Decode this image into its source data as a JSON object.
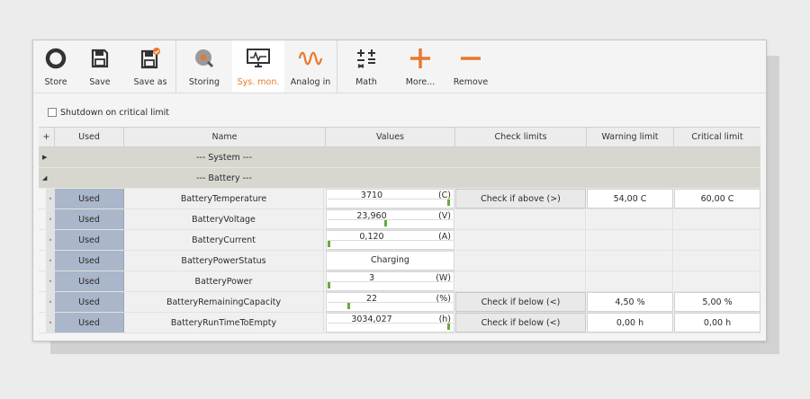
{
  "toolbar": {
    "groups": [
      [
        {
          "id": "store",
          "label": "Store",
          "icon": "circle-record-icon"
        },
        {
          "id": "save",
          "label": "Save",
          "icon": "floppy-disk-icon"
        },
        {
          "id": "saveas",
          "label": "Save as",
          "icon": "floppy-disk-edit-icon"
        }
      ],
      [
        {
          "id": "storing",
          "label": "Storing",
          "icon": "storing-disc-icon"
        },
        {
          "id": "sysmon",
          "label": "Sys. mon.",
          "icon": "monitor-waveform-icon",
          "active": true
        },
        {
          "id": "analogin",
          "label": "Analog in",
          "icon": "sine-wave-icon"
        }
      ],
      [
        {
          "id": "math",
          "label": "Math",
          "icon": "math-operators-icon"
        },
        {
          "id": "more",
          "label": "More...",
          "icon": "plus-icon"
        },
        {
          "id": "remove",
          "label": "Remove",
          "icon": "minus-icon"
        }
      ]
    ]
  },
  "shutdown_checkbox": {
    "label": "Shutdown on critical limit",
    "checked": false
  },
  "table": {
    "headers": {
      "expand": "+",
      "used": "Used",
      "name": "Name",
      "values": "Values",
      "check": "Check limits",
      "warning": "Warning limit",
      "critical": "Critical limit"
    },
    "groups": [
      {
        "label": "--- System ---",
        "expanded": false
      },
      {
        "label": "--- Battery ---",
        "expanded": true
      }
    ],
    "rows": [
      {
        "used": "Used",
        "name": "BatteryTemperature",
        "value": "3710",
        "unit": "(C)",
        "level": 0.98,
        "check": "Check if above (>)",
        "warning": "54,00 C",
        "critical": "60,00 C"
      },
      {
        "used": "Used",
        "name": "BatteryVoltage",
        "value": "23,960",
        "unit": "(V)",
        "level": 0.45,
        "check": "",
        "warning": "",
        "critical": ""
      },
      {
        "used": "Used",
        "name": "BatteryCurrent",
        "value": "0,120",
        "unit": "(A)",
        "level": 0.0,
        "check": "",
        "warning": "",
        "critical": ""
      },
      {
        "used": "Used",
        "name": "BatteryPowerStatus",
        "value": "",
        "text": "Charging",
        "unit": "",
        "check": "",
        "warning": "",
        "critical": ""
      },
      {
        "used": "Used",
        "name": "BatteryPower",
        "value": "3",
        "unit": "(W)",
        "level": 0.0,
        "check": "",
        "warning": "",
        "critical": ""
      },
      {
        "used": "Used",
        "name": "BatteryRemainingCapacity",
        "value": "22",
        "unit": "(%)",
        "level": 0.16,
        "check": "Check if below (<)",
        "warning": "4,50 %",
        "critical": "5,00 %"
      },
      {
        "used": "Used",
        "name": "BatteryRunTimeToEmpty",
        "value": "3034,027",
        "unit": "(h)",
        "level": 0.98,
        "check": "Check if below (<)",
        "warning": "0,00 h",
        "critical": "0,00 h"
      }
    ]
  },
  "colors": {
    "accent": "#e8782c",
    "used_cell": "#aab6c9",
    "bar_marker": "#5fae3a"
  }
}
